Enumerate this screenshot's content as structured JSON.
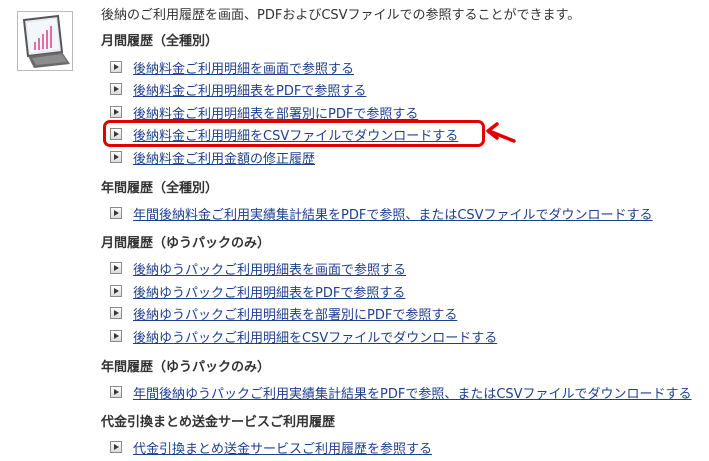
{
  "intro_text": "後納のご利用履歴を画面、PDFおよびCSVファイルでの参照することができます。",
  "thumbnail_icon": "laptop-chart-icon",
  "annotation": {
    "highlight_color": "#e10000",
    "arrow_icon": "red-arrow-icon"
  },
  "sections": [
    {
      "heading": "月間履歴（全種別）",
      "links": [
        "後納料金ご利用明細を画面で参照する",
        "後納料金ご利用明細表をPDFで参照する",
        "後納料金ご利用明細表を部署別にPDFで参照する",
        "後納料金ご利用明細をCSVファイルでダウンロードする",
        "後納料金ご利用金額の修正履歴"
      ]
    },
    {
      "heading": "年間履歴（全種別）",
      "links": [
        "年間後納料金ご利用実績集計結果をPDFで参照、またはCSVファイルでダウンロードする"
      ]
    },
    {
      "heading": "月間履歴（ゆうパックのみ）",
      "links": [
        "後納ゆうパックご利用明細表を画面で参照する",
        "後納ゆうパックご利用明細表をPDFで参照する",
        "後納ゆうパックご利用明細表を部署別にPDFで参照する",
        "後納ゆうパックご利用明細をCSVファイルでダウンロードする"
      ]
    },
    {
      "heading": "年間履歴（ゆうパックのみ）",
      "links": [
        "年間後納ゆうパックご利用実績集計結果をPDFで参照、またはCSVファイルでダウンロードする"
      ]
    },
    {
      "heading": "代金引換まとめ送金サービスご利用履歴",
      "links": [
        "代金引換まとめ送金サービスご利用履歴を参照する"
      ]
    }
  ]
}
